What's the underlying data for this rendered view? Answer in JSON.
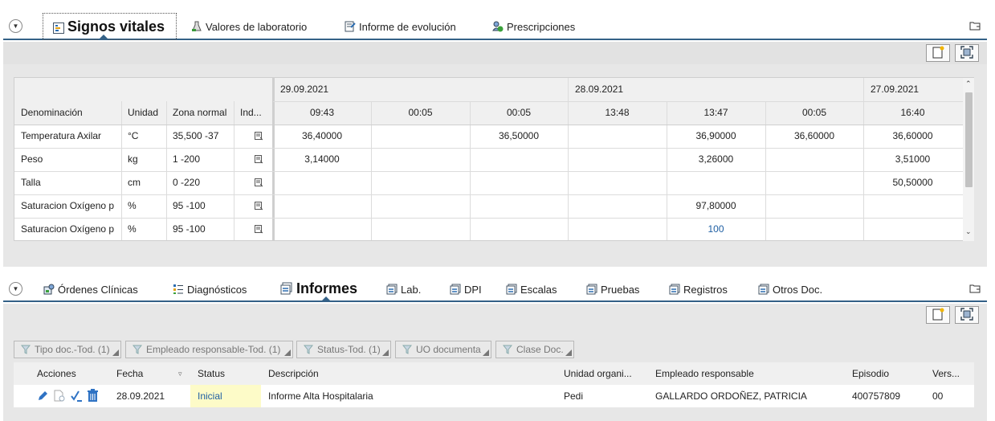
{
  "top_tabs": [
    {
      "label": "Signos vitales",
      "icon": "vitals-icon"
    },
    {
      "label": "Valores de laboratorio",
      "icon": "lab-values-icon"
    },
    {
      "label": "Informe de evolución",
      "icon": "evolution-report-icon"
    },
    {
      "label": "Prescripciones",
      "icon": "prescriptions-icon"
    }
  ],
  "vitals": {
    "columns": {
      "denominacion": "Denominación",
      "unidad": "Unidad",
      "zona": "Zona normal",
      "ind": "Ind..."
    },
    "dates": [
      "29.09.2021",
      "28.09.2021",
      "27.09.2021"
    ],
    "times": [
      "09:43",
      "00:05",
      "00:05",
      "13:48",
      "13:47",
      "00:05",
      "16:40"
    ],
    "rows": [
      {
        "name": "Temperatura Axilar",
        "unit": "°C",
        "range": "35,500 -37",
        "values": [
          "36,40000",
          "",
          "36,50000",
          "",
          "36,90000",
          "36,60000",
          "36,60000"
        ]
      },
      {
        "name": "Peso",
        "unit": "kg",
        "range": "1 -200",
        "values": [
          "3,14000",
          "",
          "",
          "",
          "3,26000",
          "",
          "3,51000"
        ]
      },
      {
        "name": "Talla",
        "unit": "cm",
        "range": "0 -220",
        "values": [
          "",
          "",
          "",
          "",
          "",
          "",
          "50,50000"
        ]
      },
      {
        "name": "Saturacion Oxígeno p",
        "unit": "%",
        "range": "95 -100",
        "values": [
          "",
          "",
          "",
          "",
          "97,80000",
          "",
          ""
        ]
      },
      {
        "name": "Saturacion Oxígeno p",
        "unit": "%",
        "range": "95 -100",
        "values": [
          "",
          "",
          "",
          "",
          "100",
          "",
          ""
        ]
      }
    ]
  },
  "bottom_tabs": [
    {
      "label": "Órdenes Clínicas",
      "icon": "clinical-orders-icon"
    },
    {
      "label": "Diagnósticos",
      "icon": "diagnoses-icon"
    },
    {
      "label": "Informes",
      "icon": "reports-icon"
    },
    {
      "label": "Lab.",
      "icon": "document-icon"
    },
    {
      "label": "DPI",
      "icon": "document-icon"
    },
    {
      "label": "Escalas",
      "icon": "document-icon"
    },
    {
      "label": "Pruebas",
      "icon": "document-icon"
    },
    {
      "label": "Registros",
      "icon": "document-icon"
    },
    {
      "label": "Otros Doc.",
      "icon": "document-icon"
    }
  ],
  "filters": [
    "Tipo doc.-Tod. (1)",
    "Empleado responsable-Tod. (1)",
    "Status-Tod. (1)",
    "UO documenta",
    "Clase Doc."
  ],
  "documents": {
    "columns": {
      "acciones": "Acciones",
      "fecha": "Fecha",
      "status": "Status",
      "descripcion": "Descripción",
      "unidad": "Unidad organi...",
      "empleado": "Empleado responsable",
      "episodio": "Episodio",
      "version": "Vers..."
    },
    "rows": [
      {
        "fecha": "28.09.2021",
        "status": "Inicial",
        "descripcion": "Informe Alta Hospitalaria",
        "unidad": "Pedi",
        "empleado": "GALLARDO ORDOÑEZ, PATRICIA",
        "episodio": "400757809",
        "version": "00"
      }
    ]
  },
  "colors": {
    "accent": "#346187",
    "link": "#1f5fa3",
    "status_highlight": "#fdfbc8",
    "panel_grey": "#e7e7e7"
  }
}
